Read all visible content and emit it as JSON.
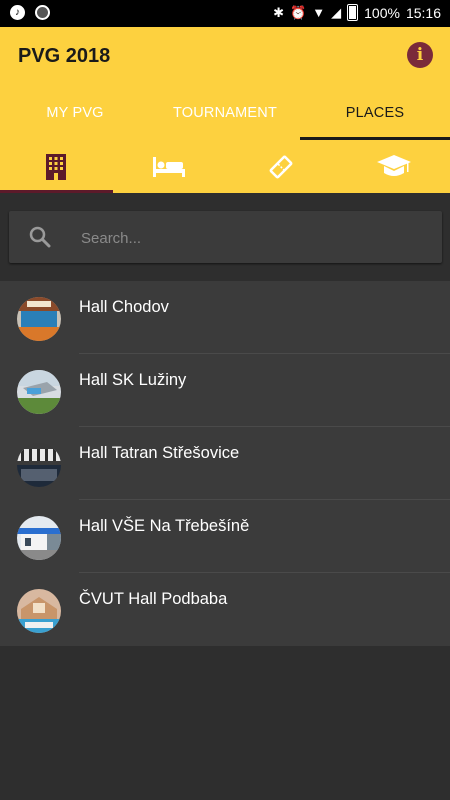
{
  "status_bar": {
    "battery": "100%",
    "time": "15:16"
  },
  "app": {
    "title": "PVG 2018"
  },
  "tabs": [
    {
      "label": "MY PVG"
    },
    {
      "label": "TOURNAMENT"
    },
    {
      "label": "PLACES"
    }
  ],
  "subtabs": [
    {
      "icon": "building-icon",
      "active": true
    },
    {
      "icon": "bed-icon",
      "active": false
    },
    {
      "icon": "ticket-icon",
      "active": false
    },
    {
      "icon": "graduation-cap-icon",
      "active": false
    }
  ],
  "search": {
    "placeholder": "Search..."
  },
  "places": [
    {
      "name": "Hall Chodov"
    },
    {
      "name": "Hall SK Lužiny"
    },
    {
      "name": "Hall Tatran Střešovice"
    },
    {
      "name": "Hall VŠE Na Třebešíně"
    },
    {
      "name": "ČVUT Hall Podbaba"
    }
  ],
  "colors": {
    "accent": "#fdd13f",
    "dark_accent": "#5c1a2a",
    "background": "#2e2e2e",
    "list_bg": "#3b3b3b"
  }
}
